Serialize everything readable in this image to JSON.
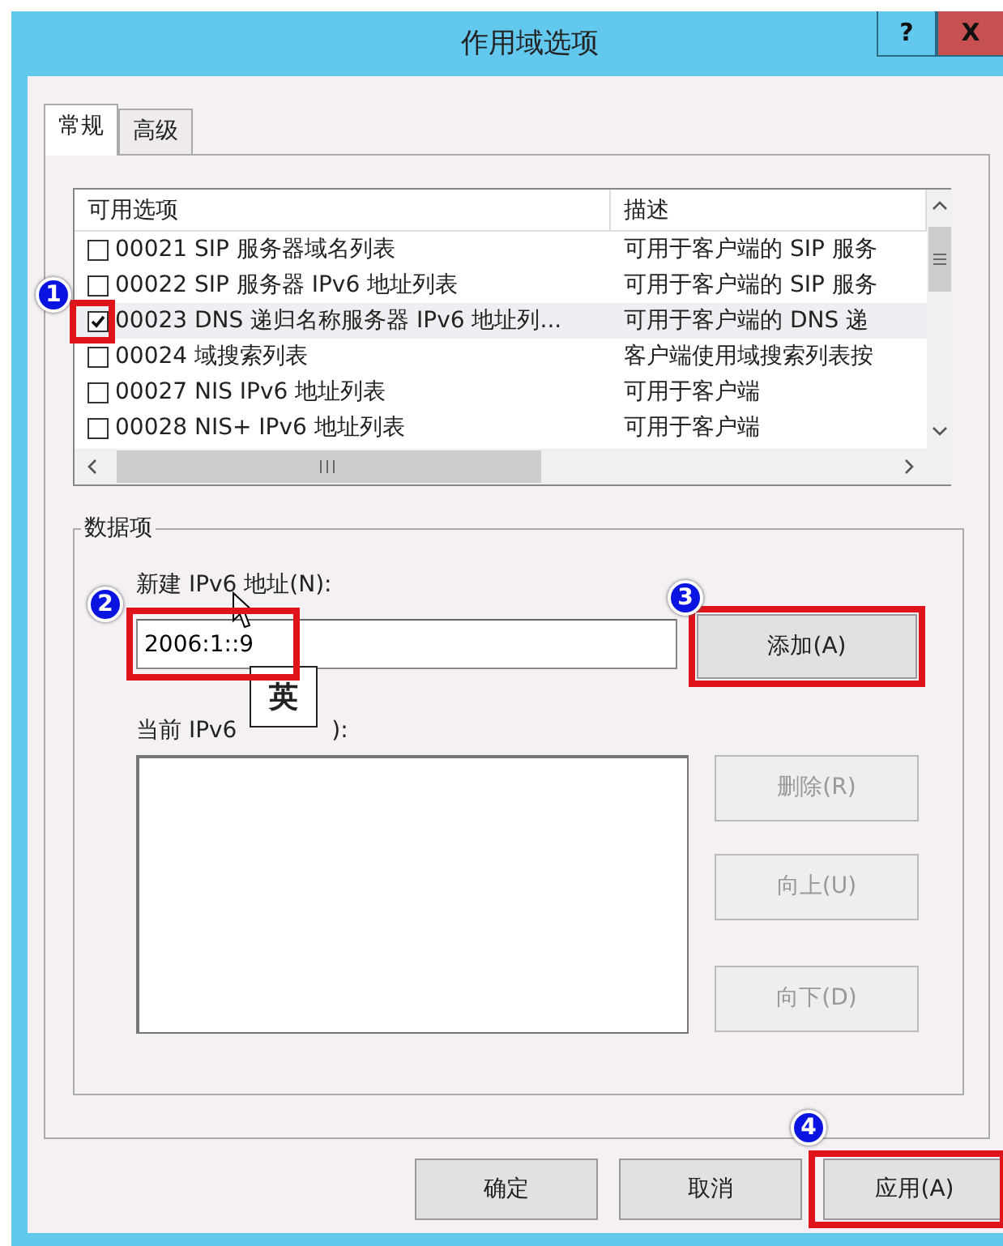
{
  "window": {
    "title": "作用域选项",
    "help_button": "?",
    "close_button": "X"
  },
  "tabs": [
    {
      "label": "常规",
      "selected": true
    },
    {
      "label": "高级",
      "selected": false
    }
  ],
  "options_list": {
    "columns": [
      "可用选项",
      "描述"
    ],
    "rows": [
      {
        "option": "00021 SIP 服务器域名列表",
        "description": "可用于客户端的 SIP 服务",
        "checked": false,
        "selected": false
      },
      {
        "option": "00022 SIP 服务器 IPv6 地址列表",
        "description": "可用于客户端的 SIP 服务",
        "checked": false,
        "selected": false
      },
      {
        "option": "00023 DNS 递归名称服务器 IPv6 地址列...",
        "description": "可用于客户端的 DNS 递",
        "checked": true,
        "selected": true,
        "callout": "1"
      },
      {
        "option": "00024 域搜索列表",
        "description": "客户端使用域搜索列表按",
        "checked": false,
        "selected": false
      },
      {
        "option": "00027 NIS IPv6 地址列表",
        "description": "可用于客户端",
        "checked": false,
        "selected": false
      },
      {
        "option": "00028 NIS+ IPv6 地址列表",
        "description": "可用于客户端",
        "checked": false,
        "selected": false
      }
    ]
  },
  "data_entry": {
    "title": "数据项",
    "new_label": "新建 IPv6 地址(N):",
    "new_value": "2006:1::9",
    "new_callout": "2",
    "ime_indicator": "英",
    "add_button": {
      "label": "添加(A)",
      "callout": "3"
    },
    "current_label": [
      "当前 IPv6",
      "):"
    ],
    "side_buttons": [
      {
        "label": "删除(R)",
        "disabled": true
      },
      {
        "label": "向上(U)",
        "disabled": true
      },
      {
        "label": "向下(D)",
        "disabled": true
      }
    ]
  },
  "footer_buttons": [
    {
      "label": "确定"
    },
    {
      "label": "取消"
    },
    {
      "label": "应用(A)",
      "callout": "4"
    }
  ]
}
